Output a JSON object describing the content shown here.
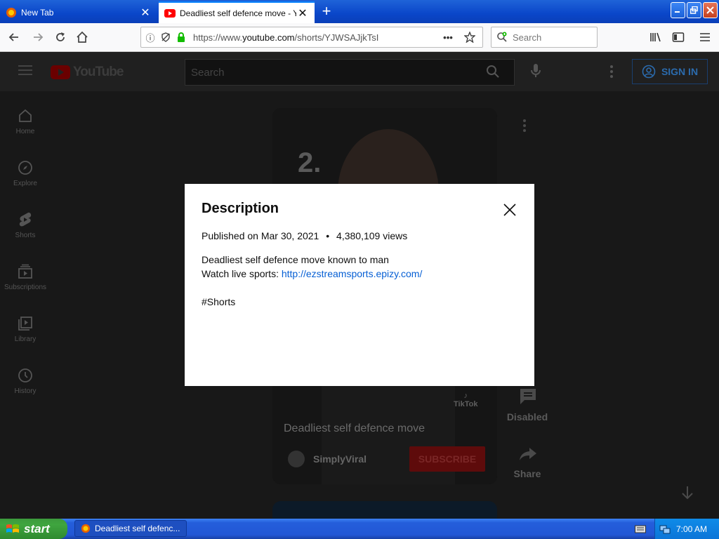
{
  "browser": {
    "tabs": [
      {
        "label": "New Tab"
      },
      {
        "label": "Deadliest self defence move - YouTube"
      }
    ],
    "url": {
      "prefix": "https://www.",
      "domain": "youtube.com",
      "path": "/shorts/YJWSAJjkTsI"
    },
    "search_placeholder": "Search"
  },
  "youtube": {
    "logo_text": "YouTube",
    "search_placeholder": "Search",
    "signin_label": "SIGN IN",
    "sidebar": [
      {
        "label": "Home"
      },
      {
        "label": "Explore"
      },
      {
        "label": "Shorts"
      },
      {
        "label": "Subscriptions"
      },
      {
        "label": "Library"
      },
      {
        "label": "History"
      }
    ],
    "video": {
      "overlay_number": "2.",
      "title": "Deadliest self defence move",
      "channel": "SimplyViral",
      "subscribe_label": "SUBSCRIBE",
      "watermark": "TikTok"
    },
    "actions": {
      "comments_label": "Disabled",
      "share_label": "Share"
    }
  },
  "modal": {
    "title": "Description",
    "published": "Published on Mar 30, 2021",
    "separator": "•",
    "views": "4,380,109 views",
    "line1": "Deadliest self defence move known to man",
    "line2_prefix": "Watch live sports: ",
    "link": "http://ezstreamsports.epizy.com/",
    "hashtag": "#Shorts"
  },
  "taskbar": {
    "start_label": "start",
    "task_label": "Deadliest self defenc...",
    "clock": "7:00 AM"
  }
}
